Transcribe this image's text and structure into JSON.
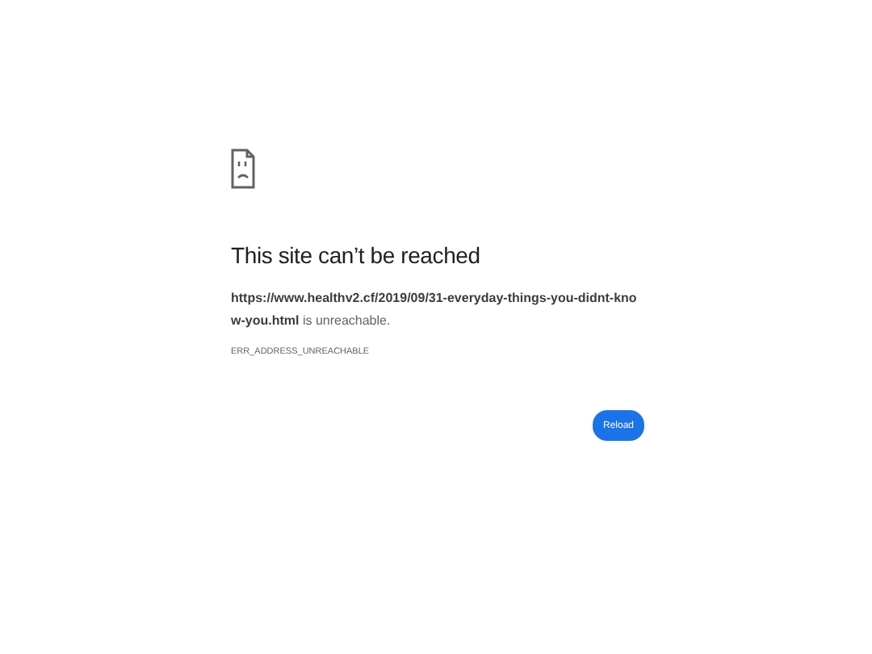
{
  "error_page": {
    "title": "This site can’t be reached",
    "message": "**https://www.healthv2.cf/2019/09/31-everyday-things-you-didnt-know-you.html** is unreachable.",
    "error_code": "ERR_ADDRESS_UNREACHABLE",
    "reload_button": "Reload"
  }
}
